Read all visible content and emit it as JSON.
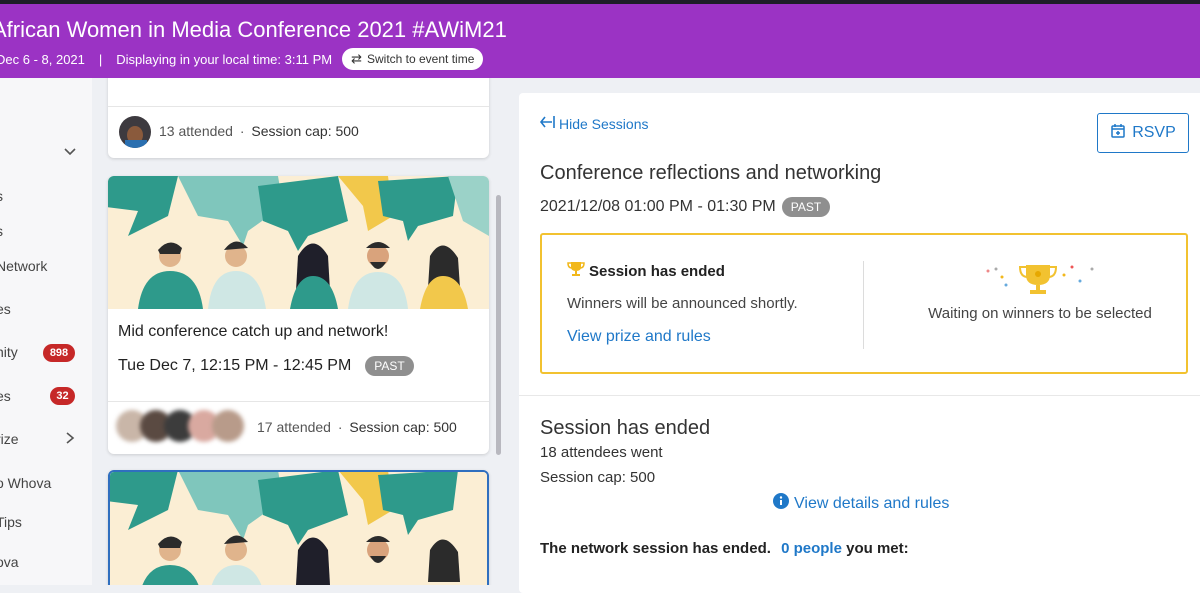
{
  "header": {
    "title": "African Women in Media Conference 2021 #AWiM21",
    "dates": "Dec 6 - 8, 2021",
    "separator": "|",
    "local_time": "Displaying in your local time: 3:11 PM",
    "switch_label": "Switch to event time"
  },
  "sidebar": {
    "items": [
      {
        "label": "s"
      },
      {
        "label": "s"
      },
      {
        "label": "Network"
      },
      {
        "label": "es"
      },
      {
        "label": "nity",
        "badge": "898"
      },
      {
        "label": "es",
        "badge": "32"
      },
      {
        "label": "rize"
      },
      {
        "label": "o Whova"
      },
      {
        "label": "Tips"
      },
      {
        "label": "ova"
      }
    ]
  },
  "sessions": [
    {
      "attended": "13 attended",
      "cap": "Session cap: 500"
    },
    {
      "title": "Mid conference catch up and network!",
      "time": "Tue Dec 7, 12:15 PM - 12:45 PM",
      "status": "PAST",
      "attended": "17 attended",
      "cap": "Session cap: 500"
    }
  ],
  "detail": {
    "hide_sessions": "Hide Sessions",
    "rsvp": "RSVP",
    "title": "Conference reflections and networking",
    "datetime": "2021/12/08 01:00 PM - 01:30 PM",
    "status": "PAST",
    "prize": {
      "heading": "Session has ended",
      "text": "Winners will be announced shortly.",
      "link": "View prize and rules",
      "waiting": "Waiting on winners to be selected"
    },
    "ended": {
      "heading": "Session has ended",
      "attendees": "18 attendees went",
      "cap": "Session cap: 500",
      "details_link": "View details and rules",
      "network_prefix": "The network session has ended.",
      "people": "0 people",
      "network_suffix": "you met:"
    }
  },
  "colors": {
    "header": "#9b33c4",
    "link": "#1f78c8",
    "badge": "#c62828",
    "prize_border": "#f2c230"
  }
}
